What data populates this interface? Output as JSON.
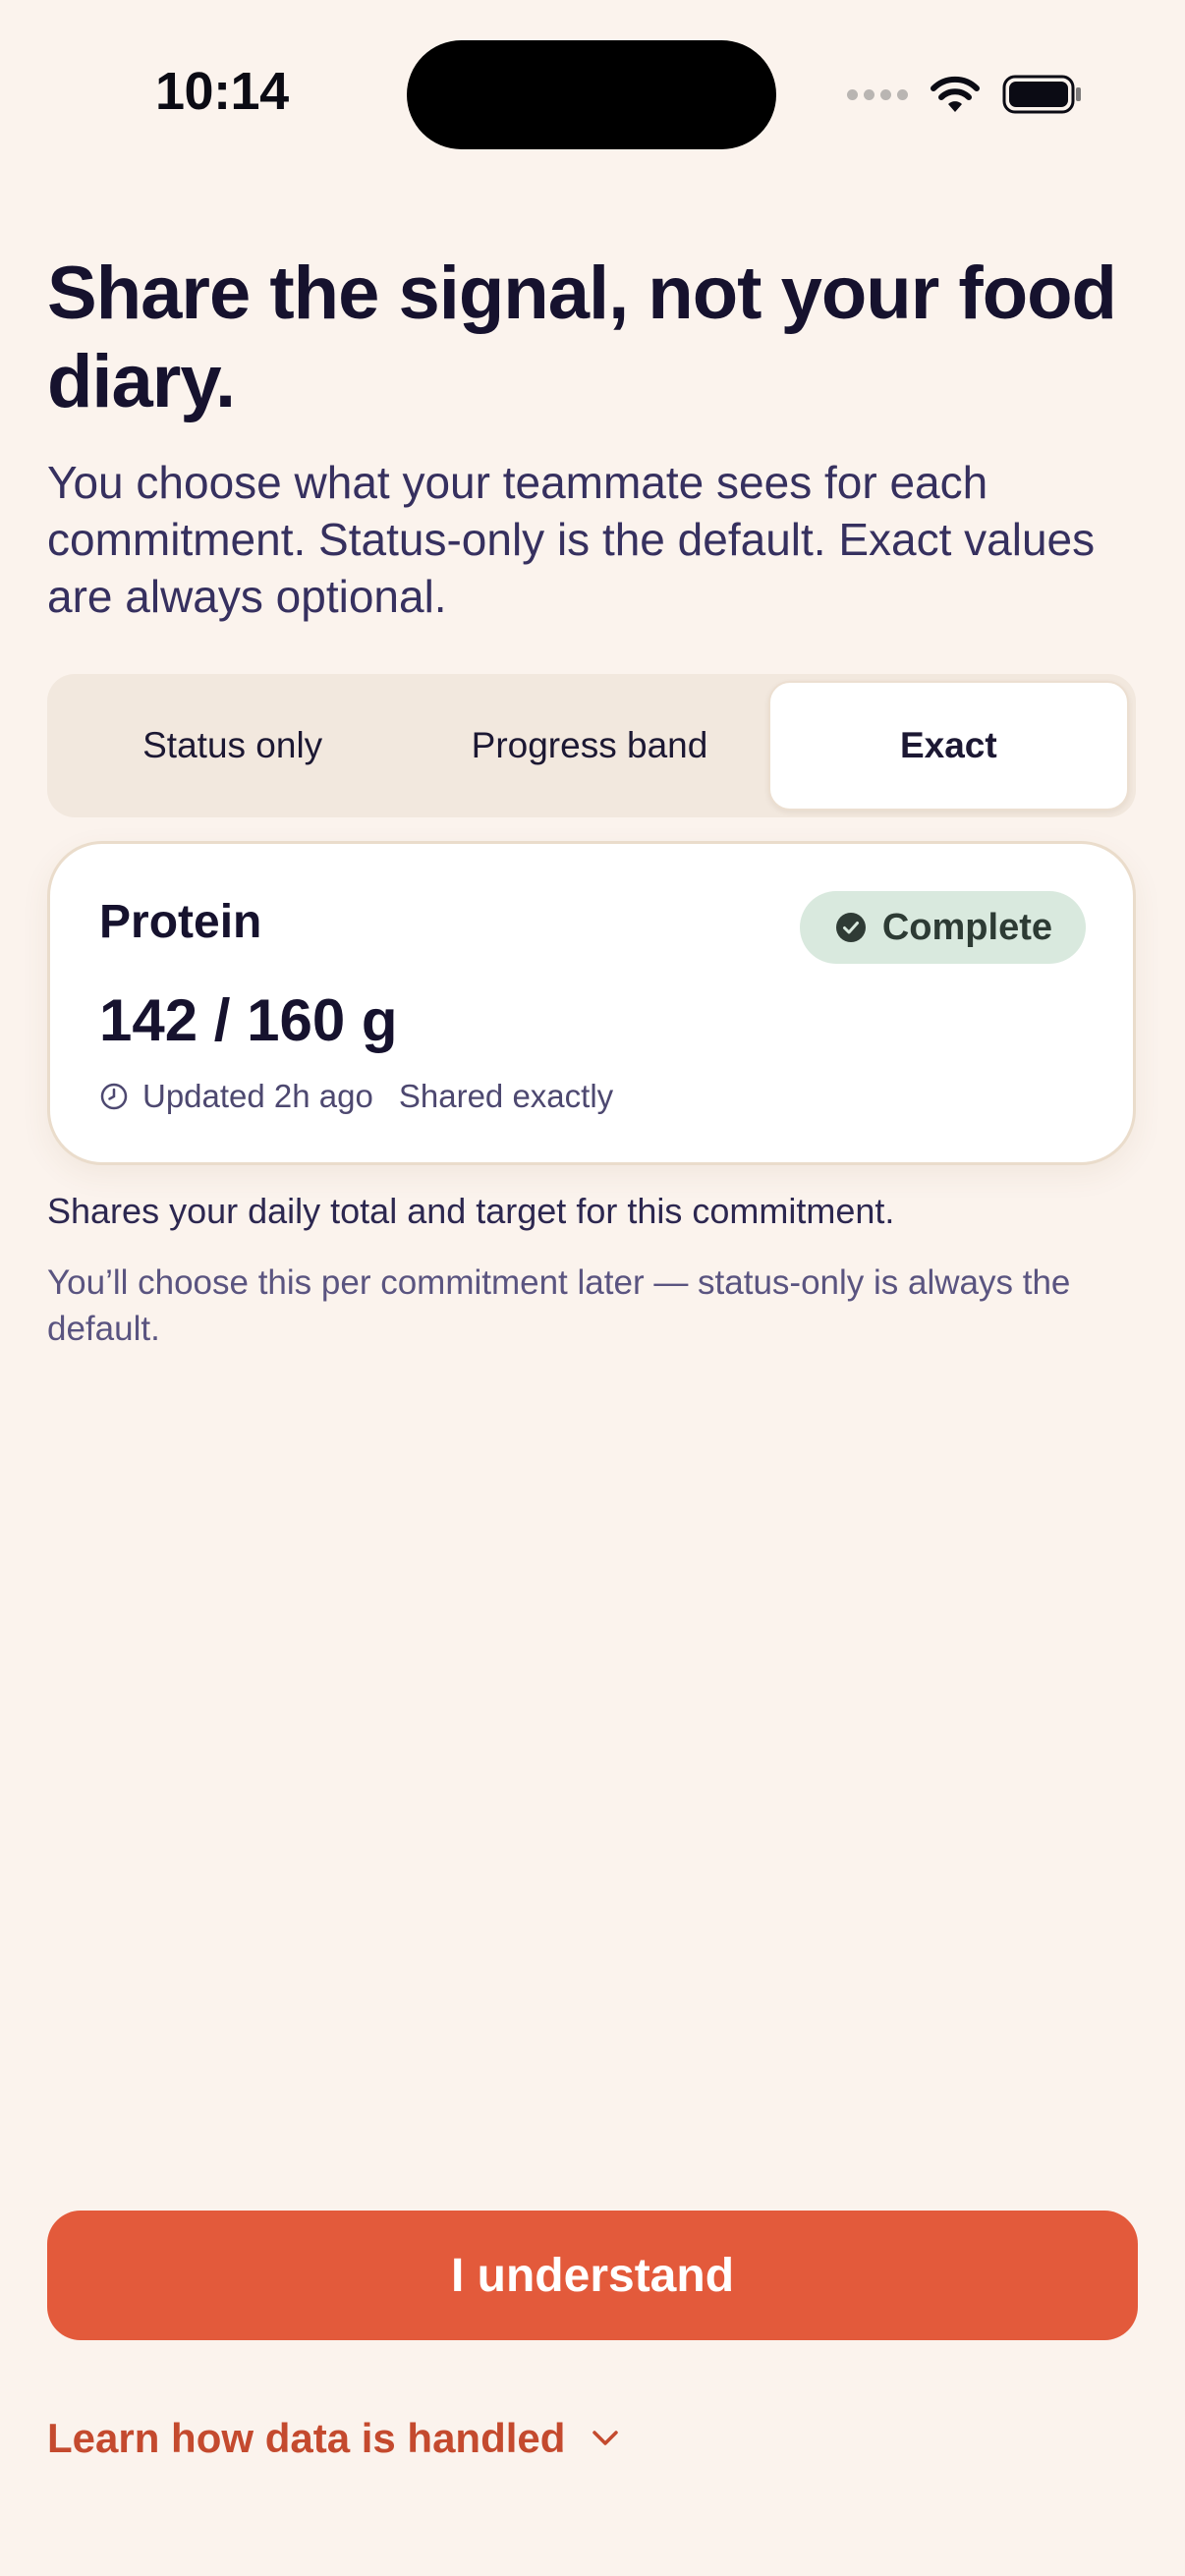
{
  "status_bar": {
    "time": "10:14",
    "icons": [
      "signal-dots-icon",
      "wifi-icon",
      "battery-icon"
    ]
  },
  "header": {
    "title": "Share the signal, not your food diary.",
    "subtitle": "You choose what your teammate sees for each commitment. Status-only is the default. Exact values are always optional."
  },
  "segmented": {
    "options": [
      "Status only",
      "Progress band",
      "Exact"
    ],
    "selected": "Exact"
  },
  "card": {
    "title": "Protein",
    "badge": "Complete",
    "value": "142 / 160 g",
    "updated": "Updated 2h ago",
    "shared": "Shared exactly",
    "icons": [
      "check-circle-icon",
      "clock-icon"
    ]
  },
  "explanation": "Shares your daily total and target for this commitment.",
  "note": "You’ll choose this per commitment later — status-only is always the default.",
  "actions": {
    "primary_label": "I understand",
    "learn_label": "Learn how data is handled"
  },
  "colors": {
    "background": "#fbf3ed",
    "accent": "#e35a3b",
    "link": "#c44a2e",
    "badge_bg": "#d9e9de"
  }
}
